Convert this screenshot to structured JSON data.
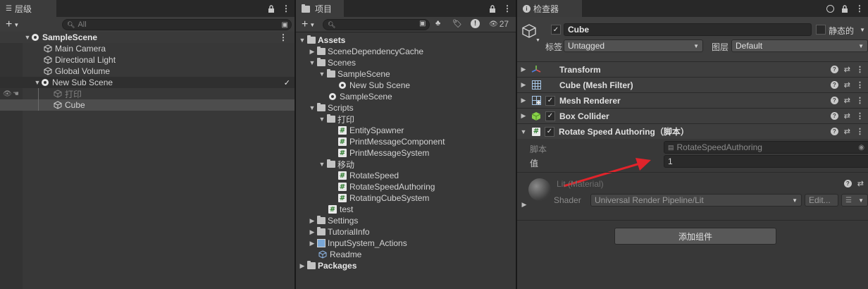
{
  "hierarchy": {
    "tab_label": "层级",
    "search_placeholder": "All",
    "scene_name": "SampleScene",
    "items": [
      {
        "label": "Main Camera"
      },
      {
        "label": "Directional Light"
      },
      {
        "label": "Global Volume"
      }
    ],
    "subscene": {
      "label": "New Sub Scene",
      "children": [
        {
          "label": "打印"
        },
        {
          "label": "Cube"
        }
      ]
    }
  },
  "project": {
    "tab_label": "项目",
    "hidden_count": "27",
    "tree": {
      "assets": "Assets",
      "scene_dependency_cache": "SceneDependencyCache",
      "scenes": "Scenes",
      "sample_scene_folder": "SampleScene",
      "new_sub_scene": "New Sub Scene",
      "sample_scene_asset": "SampleScene",
      "scripts": "Scripts",
      "print_folder": "打印",
      "entity_spawner": "EntitySpawner",
      "print_message_component": "PrintMessageComponent",
      "print_message_system": "PrintMessageSystem",
      "move_folder": "移动",
      "rotate_speed": "RotateSpeed",
      "rotate_speed_authoring": "RotateSpeedAuthoring",
      "rotating_cube_system": "RotatingCubeSystem",
      "test": "test",
      "settings": "Settings",
      "tutorial_info": "TutorialInfo",
      "input_system_actions": "InputSystem_Actions",
      "readme": "Readme",
      "packages": "Packages"
    }
  },
  "inspector": {
    "tab_label": "检查器",
    "object_name": "Cube",
    "static_label": "静态的",
    "tag_label": "标签",
    "tag_value": "Untagged",
    "layer_label": "图层",
    "layer_value": "Default",
    "components": [
      {
        "name": "Transform"
      },
      {
        "name": "Cube (Mesh Filter)"
      },
      {
        "name": "Mesh Renderer"
      },
      {
        "name": "Box Collider"
      },
      {
        "name": "Rotate Speed Authoring（脚本）"
      }
    ],
    "script_label": "脚本",
    "script_value": "RotateSpeedAuthoring",
    "value_label": "值",
    "value_value": "1",
    "material_name": "Lit (Material)",
    "shader_label": "Shader",
    "shader_value": "Universal Render Pipeline/Lit",
    "edit_label": "Edit...",
    "add_component_label": "添加组件"
  },
  "colors": {
    "panel_bg": "#383838",
    "selection": "#4d4d4d",
    "arrow_red": "#e0242b",
    "script_green": "#2b7a2b"
  }
}
